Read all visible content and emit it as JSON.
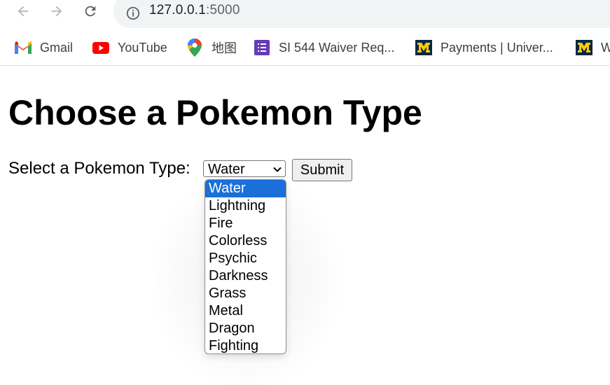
{
  "browser": {
    "url_host": "127.0.0.1",
    "url_port": ":5000",
    "bookmarks": [
      {
        "label": "Gmail",
        "icon": "gmail-icon"
      },
      {
        "label": "YouTube",
        "icon": "youtube-icon"
      },
      {
        "label": "地图",
        "icon": "maps-icon"
      },
      {
        "label": "SI 544 Waiver Req...",
        "icon": "forms-icon"
      },
      {
        "label": "Payments | Univer...",
        "icon": "umich-icon"
      },
      {
        "label": "W",
        "icon": "umich-icon"
      }
    ]
  },
  "page": {
    "title": "Choose a Pokemon Type",
    "form_label": "Select a Pokemon Type:",
    "selected_type": "Water",
    "submit_label": "Submit",
    "options": [
      "Water",
      "Lightning",
      "Fire",
      "Colorless",
      "Psychic",
      "Darkness",
      "Grass",
      "Metal",
      "Dragon",
      "Fighting"
    ]
  },
  "colors": {
    "selected_option_bg": "#1a6fd9",
    "youtube_red": "#ff0000",
    "umich_blue": "#00274c",
    "umich_maize": "#ffcb05",
    "forms_purple": "#673ab7"
  }
}
